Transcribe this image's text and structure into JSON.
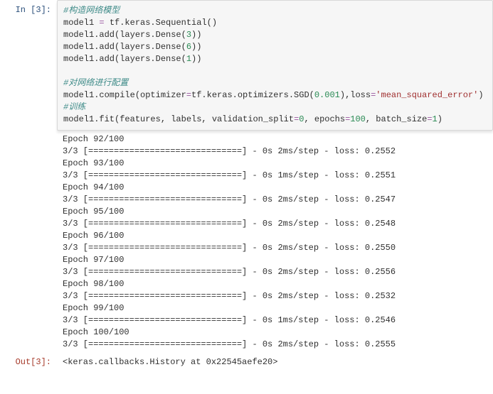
{
  "prompts": {
    "in_label": "In  [3]:",
    "out_label": "Out[3]:"
  },
  "code": {
    "c1": "#构造网络模型",
    "l2a": "model1 ",
    "l2b": "=",
    "l2c": " tf.keras.Sequential()",
    "l3a": "model1.add(layers.Dense(",
    "l3n": "3",
    "l3b": "))",
    "l4a": "model1.add(layers.Dense(",
    "l4n": "6",
    "l4b": "))",
    "l5a": "model1.add(layers.Dense(",
    "l5n": "1",
    "l5b": "))",
    "c2": "#对网络进行配置",
    "l7a": "model1.compile(optimizer",
    "l7eq1": "=",
    "l7b": "tf.keras.optimizers.SGD(",
    "l7n": "0.001",
    "l7c": "),loss",
    "l7eq2": "=",
    "l7s": "'mean_squared_error'",
    "l7d": ")",
    "c3": "#训练",
    "l9a": "model1.fit(features, labels, validation_split",
    "l9eq1": "=",
    "l9n1": "0",
    "l9b": ", epochs",
    "l9eq2": "=",
    "l9n2": "100",
    "l9c": ", batch_size",
    "l9eq3": "=",
    "l9n3": "1",
    "l9d": ")"
  },
  "epochs": [
    {
      "hdr": "Epoch 92/100",
      "bar": "3/3 [==============================] - 0s 2ms/step - loss: 0.2552"
    },
    {
      "hdr": "Epoch 93/100",
      "bar": "3/3 [==============================] - 0s 1ms/step - loss: 0.2551"
    },
    {
      "hdr": "Epoch 94/100",
      "bar": "3/3 [==============================] - 0s 2ms/step - loss: 0.2547"
    },
    {
      "hdr": "Epoch 95/100",
      "bar": "3/3 [==============================] - 0s 2ms/step - loss: 0.2548"
    },
    {
      "hdr": "Epoch 96/100",
      "bar": "3/3 [==============================] - 0s 2ms/step - loss: 0.2550"
    },
    {
      "hdr": "Epoch 97/100",
      "bar": "3/3 [==============================] - 0s 2ms/step - loss: 0.2556"
    },
    {
      "hdr": "Epoch 98/100",
      "bar": "3/3 [==============================] - 0s 2ms/step - loss: 0.2532"
    },
    {
      "hdr": "Epoch 99/100",
      "bar": "3/3 [==============================] - 0s 1ms/step - loss: 0.2546"
    },
    {
      "hdr": "Epoch 100/100",
      "bar": "3/3 [==============================] - 0s 2ms/step - loss: 0.2555"
    }
  ],
  "out_value": "<keras.callbacks.History at 0x22545aefe20>"
}
